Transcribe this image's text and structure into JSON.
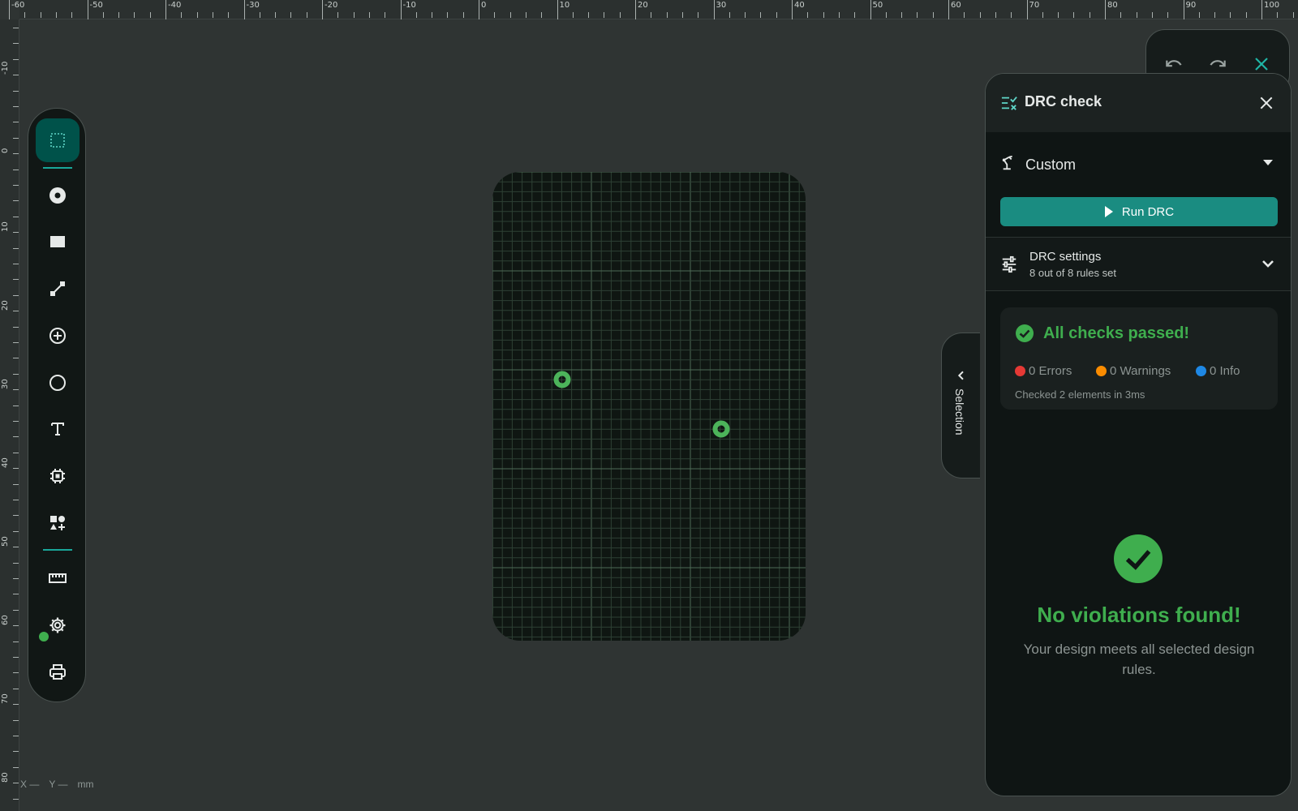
{
  "rulers": {
    "top_labels": [
      "-60",
      "-50",
      "-40",
      "-30",
      "-20",
      "-10",
      "0",
      "10",
      "20",
      "30",
      "40",
      "50",
      "60",
      "70",
      "80",
      "90",
      "100"
    ],
    "left_labels": [
      "-10",
      "0",
      "10",
      "20",
      "30",
      "40",
      "50",
      "60",
      "70",
      "80"
    ]
  },
  "toolbar": {
    "tools": [
      {
        "name": "select-tool",
        "icon": "dashed-rect-icon",
        "active": true
      },
      {
        "name": "pad-tool",
        "icon": "pad-icon"
      },
      {
        "name": "rectangle-tool",
        "icon": "rect-icon"
      },
      {
        "name": "trace-tool",
        "icon": "trace-icon"
      },
      {
        "name": "via-tool",
        "icon": "plus-circle-icon"
      },
      {
        "name": "circle-tool",
        "icon": "circle-icon"
      },
      {
        "name": "text-tool",
        "icon": "text-icon"
      },
      {
        "name": "component-tool",
        "icon": "chip-icon"
      },
      {
        "name": "shapes-tool",
        "icon": "shapes-icon"
      },
      {
        "name": "measure-tool",
        "icon": "ruler-icon"
      },
      {
        "name": "settings-tool",
        "icon": "gear-icon"
      },
      {
        "name": "print-tool",
        "icon": "printer-icon"
      }
    ]
  },
  "coords": {
    "x_label": "X —",
    "y_label": "Y —",
    "unit": "mm"
  },
  "selection_tab": {
    "label": "Selection"
  },
  "panel": {
    "title": "DRC check",
    "profile": "Custom",
    "run_label": "Run DRC",
    "settings_title": "DRC settings",
    "settings_sub": "8 out of 8 rules set",
    "summary_title": "All checks passed!",
    "errors": "0 Errors",
    "warnings": "0 Warnings",
    "info": "0 Info",
    "note": "Checked 2 elements in 3ms",
    "big_title": "No violations found!",
    "big_sub": "Your design meets all selected design rules."
  },
  "colors": {
    "accent": "#1a8c81",
    "success": "#3fae4e",
    "error": "#e53935",
    "warning": "#fb8c00",
    "info": "#1e88e5"
  }
}
